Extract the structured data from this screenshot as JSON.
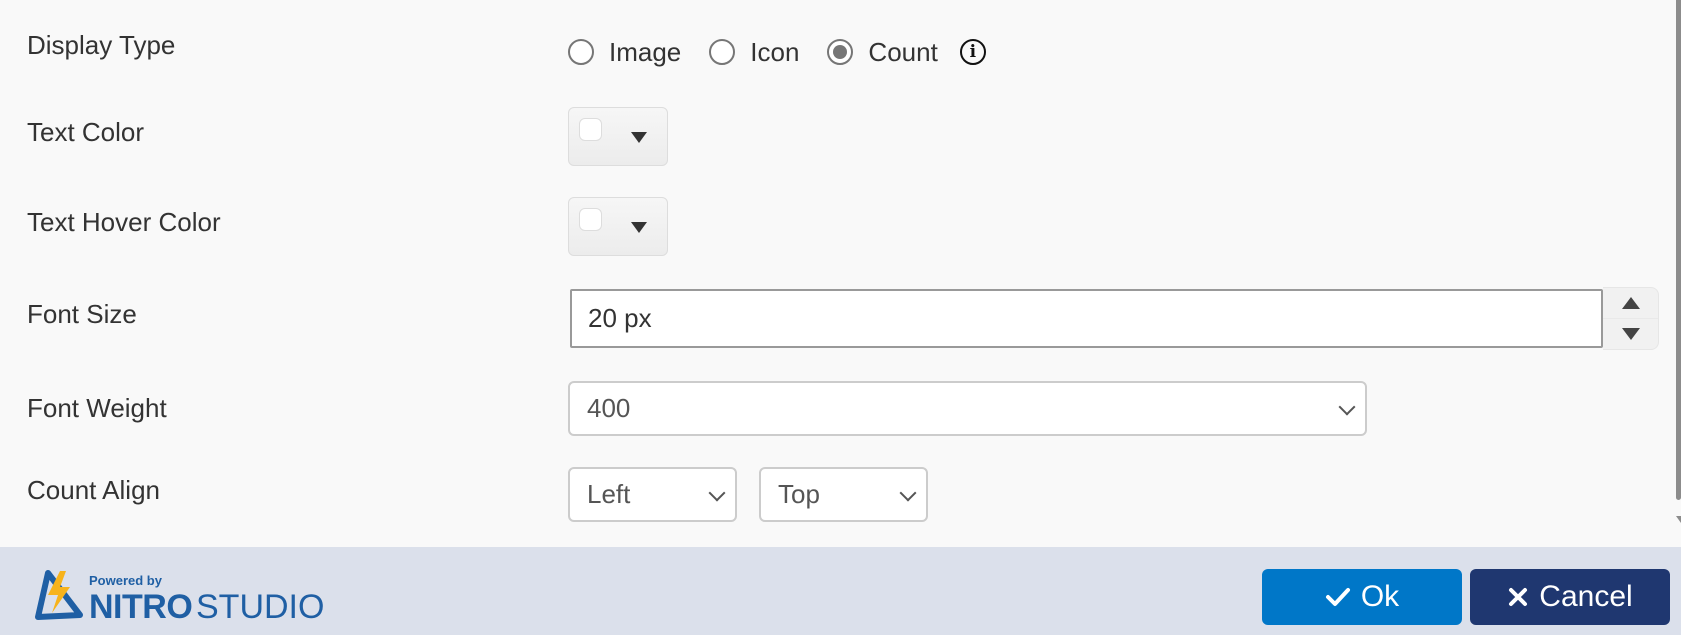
{
  "form": {
    "display_type": {
      "label": "Display Type",
      "options": [
        {
          "label": "Image",
          "checked": false
        },
        {
          "label": "Icon",
          "checked": false
        },
        {
          "label": "Count",
          "checked": true
        }
      ],
      "info_icon": "info-icon"
    },
    "text_color": {
      "label": "Text Color",
      "value": "#ffffff"
    },
    "text_hover_color": {
      "label": "Text Hover Color",
      "value": "#ffffff"
    },
    "font_size": {
      "label": "Font Size",
      "value": "20 px"
    },
    "font_weight": {
      "label": "Font Weight",
      "value": "400"
    },
    "count_align": {
      "label": "Count Align",
      "horizontal": "Left",
      "vertical": "Top"
    }
  },
  "footer": {
    "logo": {
      "powered_by": "Powered by",
      "brand_bold": "NITRO",
      "brand_light": "STUDIO"
    },
    "ok_label": "Ok",
    "cancel_label": "Cancel",
    "colors": {
      "ok": "#0077c8",
      "cancel": "#1f3770",
      "brand": "#1f5fa4",
      "bolt": "#f7b31b"
    }
  }
}
